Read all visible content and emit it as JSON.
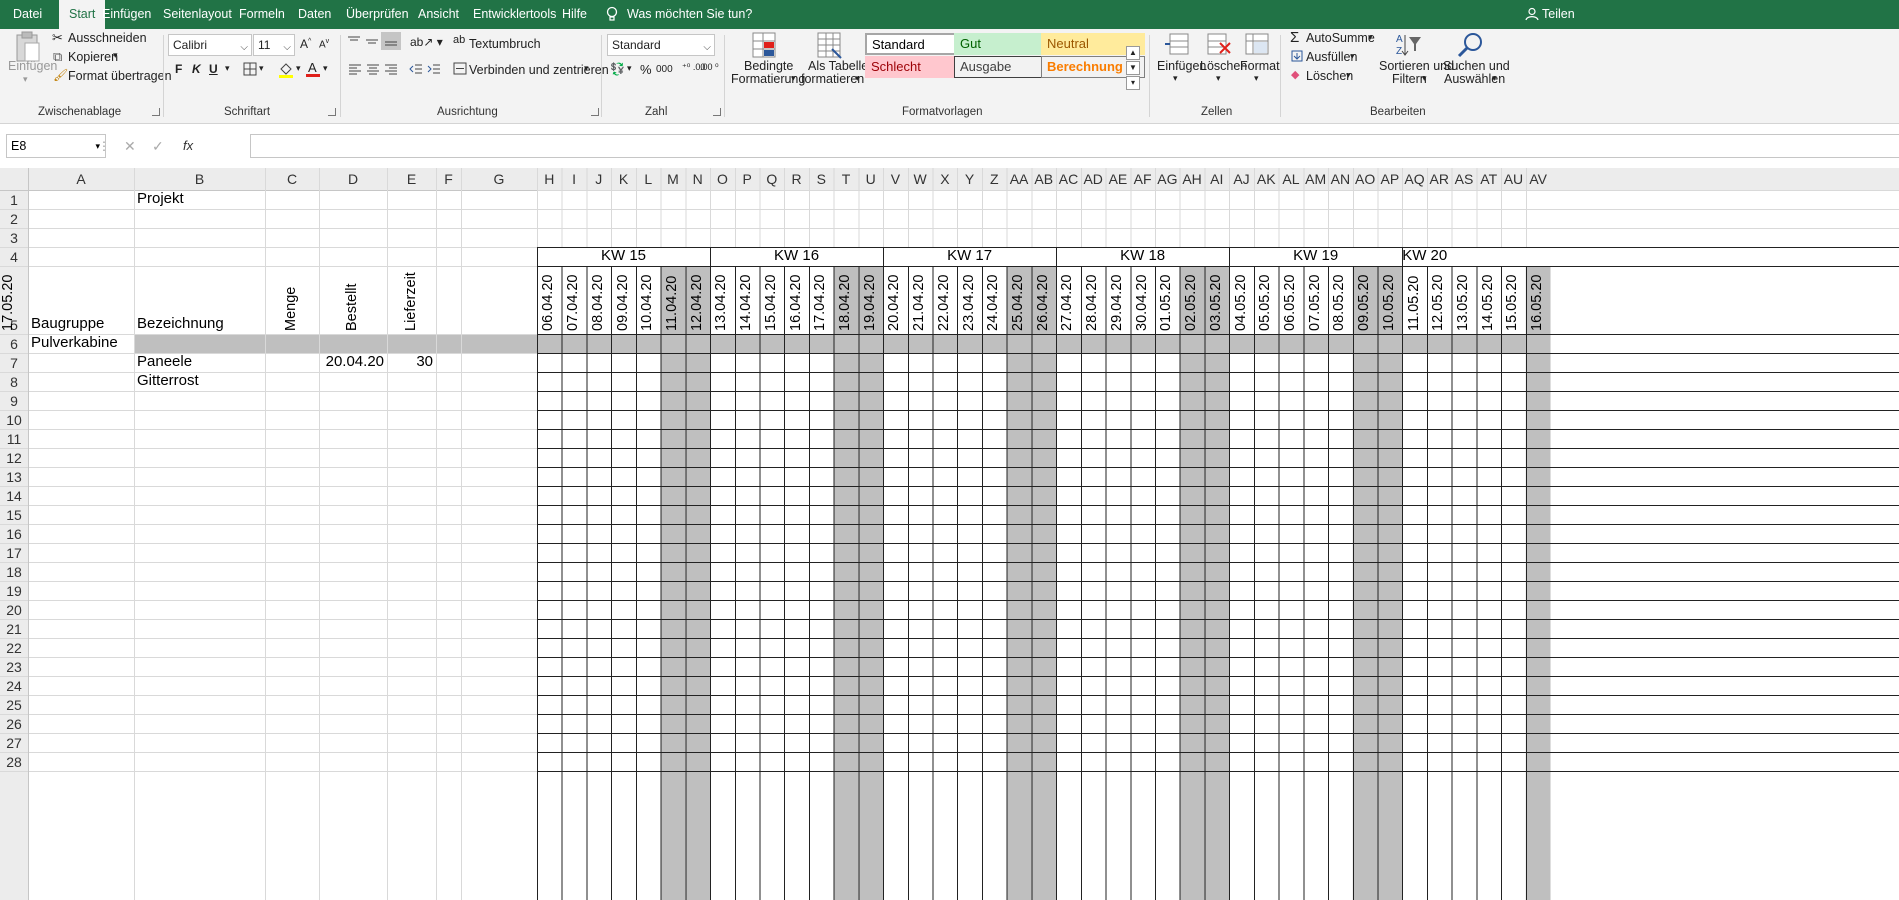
{
  "menu": {
    "tabs": [
      "Datei",
      "Start",
      "Einfügen",
      "Seitenlayout",
      "Formeln",
      "Daten",
      "Überprüfen",
      "Ansicht",
      "Entwicklertools",
      "Hilfe"
    ],
    "active_tab": "Start",
    "tellme": "Was möchten Sie tun?",
    "share": "Teilen"
  },
  "ribbon": {
    "clipboard": {
      "paste": "Einfügen",
      "cut": "Ausschneiden",
      "copy": "Kopieren",
      "format_painter": "Format übertragen",
      "group": "Zwischenablage"
    },
    "font": {
      "name": "Calibri",
      "size": "11",
      "bold": "F",
      "italic": "K",
      "underline": "U",
      "group": "Schriftart"
    },
    "alignment": {
      "wrap": "Textumbruch",
      "merge": "Verbinden und zentrieren",
      "group": "Ausrichtung"
    },
    "number": {
      "format": "Standard",
      "percent": "%",
      "thousands": "000",
      "group": "Zahl"
    },
    "styles": {
      "conditional": [
        "Bedingte",
        "Formatierung"
      ],
      "as_table": [
        "Als Tabelle",
        "formatieren"
      ],
      "cells": [
        {
          "label": "Standard",
          "bg": "#ffffff",
          "fg": "#000000",
          "border": "#a6a6a6"
        },
        {
          "label": "Gut",
          "bg": "#c6efce",
          "fg": "#006100",
          "border": "#c6efce"
        },
        {
          "label": "Neutral",
          "bg": "#ffeb9c",
          "fg": "#9c5700",
          "border": "#ffeb9c"
        },
        {
          "label": "Schlecht",
          "bg": "#ffc7ce",
          "fg": "#9c0006",
          "border": "#ffc7ce"
        },
        {
          "label": "Ausgabe",
          "bg": "#f2f2f2",
          "fg": "#3f3f3f",
          "border": "#3f3f3f"
        },
        {
          "label": "Berechnung",
          "bg": "#f2f2f2",
          "fg": "#fa7d00",
          "border": "#7f7f7f"
        }
      ],
      "group": "Formatvorlagen"
    },
    "cells_group": {
      "insert": "Einfügen",
      "delete": "Löschen",
      "format": "Format",
      "group": "Zellen"
    },
    "editing": {
      "autosum": "AutoSumme",
      "fill": "Ausfüllen",
      "clear": "Löschen",
      "sort": [
        "Sortieren und",
        "Filtern"
      ],
      "find": [
        "Suchen und",
        "Auswählen"
      ],
      "group": "Bearbeiten"
    }
  },
  "formula_bar": {
    "name_box": "E8",
    "fx": "fx",
    "formula": ""
  },
  "sheet": {
    "columns": [
      "A",
      "B",
      "C",
      "D",
      "E",
      "F",
      "G",
      "H",
      "I",
      "J",
      "K",
      "L",
      "M",
      "N",
      "O",
      "P",
      "Q",
      "R",
      "S",
      "T",
      "U",
      "V",
      "W",
      "X",
      "Y",
      "Z",
      "AA",
      "AB",
      "AC",
      "AD",
      "AE",
      "AF",
      "AG",
      "AH",
      "AI",
      "AJ",
      "AK",
      "AL",
      "AM",
      "AN",
      "AO",
      "AP",
      "AQ",
      "AR",
      "AS",
      "AT",
      "AU",
      "AV"
    ],
    "rows": [
      "1",
      "2",
      "3",
      "4",
      "5",
      "6",
      "7",
      "8",
      "9",
      "10",
      "11",
      "12",
      "13",
      "14",
      "15",
      "16",
      "17",
      "18",
      "19",
      "20",
      "21",
      "22",
      "23",
      "24",
      "25",
      "26",
      "27",
      "28"
    ],
    "cells": {
      "B1": "Projekt",
      "A5": "Baugruppe",
      "B5": "Bezeichnung",
      "A6": "Pulverkabine",
      "B7": "Paneele",
      "D7": "20.04.20",
      "E7": "30",
      "B8": "Gitterrost"
    },
    "rotated_headers": {
      "C5": "Menge",
      "D5": "Bestellt",
      "E5": "Lieferzeit"
    },
    "weeks": [
      "KW 15",
      "KW 16",
      "KW 17",
      "KW 18",
      "KW 19",
      "KW 20"
    ],
    "dates": [
      "06.04.20",
      "07.04.20",
      "08.04.20",
      "09.04.20",
      "10.04.20",
      "11.04.20",
      "12.04.20",
      "13.04.20",
      "14.04.20",
      "15.04.20",
      "16.04.20",
      "17.04.20",
      "18.04.20",
      "19.04.20",
      "20.04.20",
      "21.04.20",
      "22.04.20",
      "23.04.20",
      "24.04.20",
      "25.04.20",
      "26.04.20",
      "27.04.20",
      "28.04.20",
      "29.04.20",
      "30.04.20",
      "01.05.20",
      "02.05.20",
      "03.05.20",
      "04.05.20",
      "05.05.20",
      "06.05.20",
      "07.05.20",
      "08.05.20",
      "09.05.20",
      "10.05.20",
      "11.05.20",
      "12.05.20",
      "13.05.20",
      "14.05.20",
      "15.05.20",
      "16.05.20",
      "17.05.20"
    ],
    "weekend_color": "#bfbfbf",
    "row6_fill": "#bfbfbf"
  }
}
